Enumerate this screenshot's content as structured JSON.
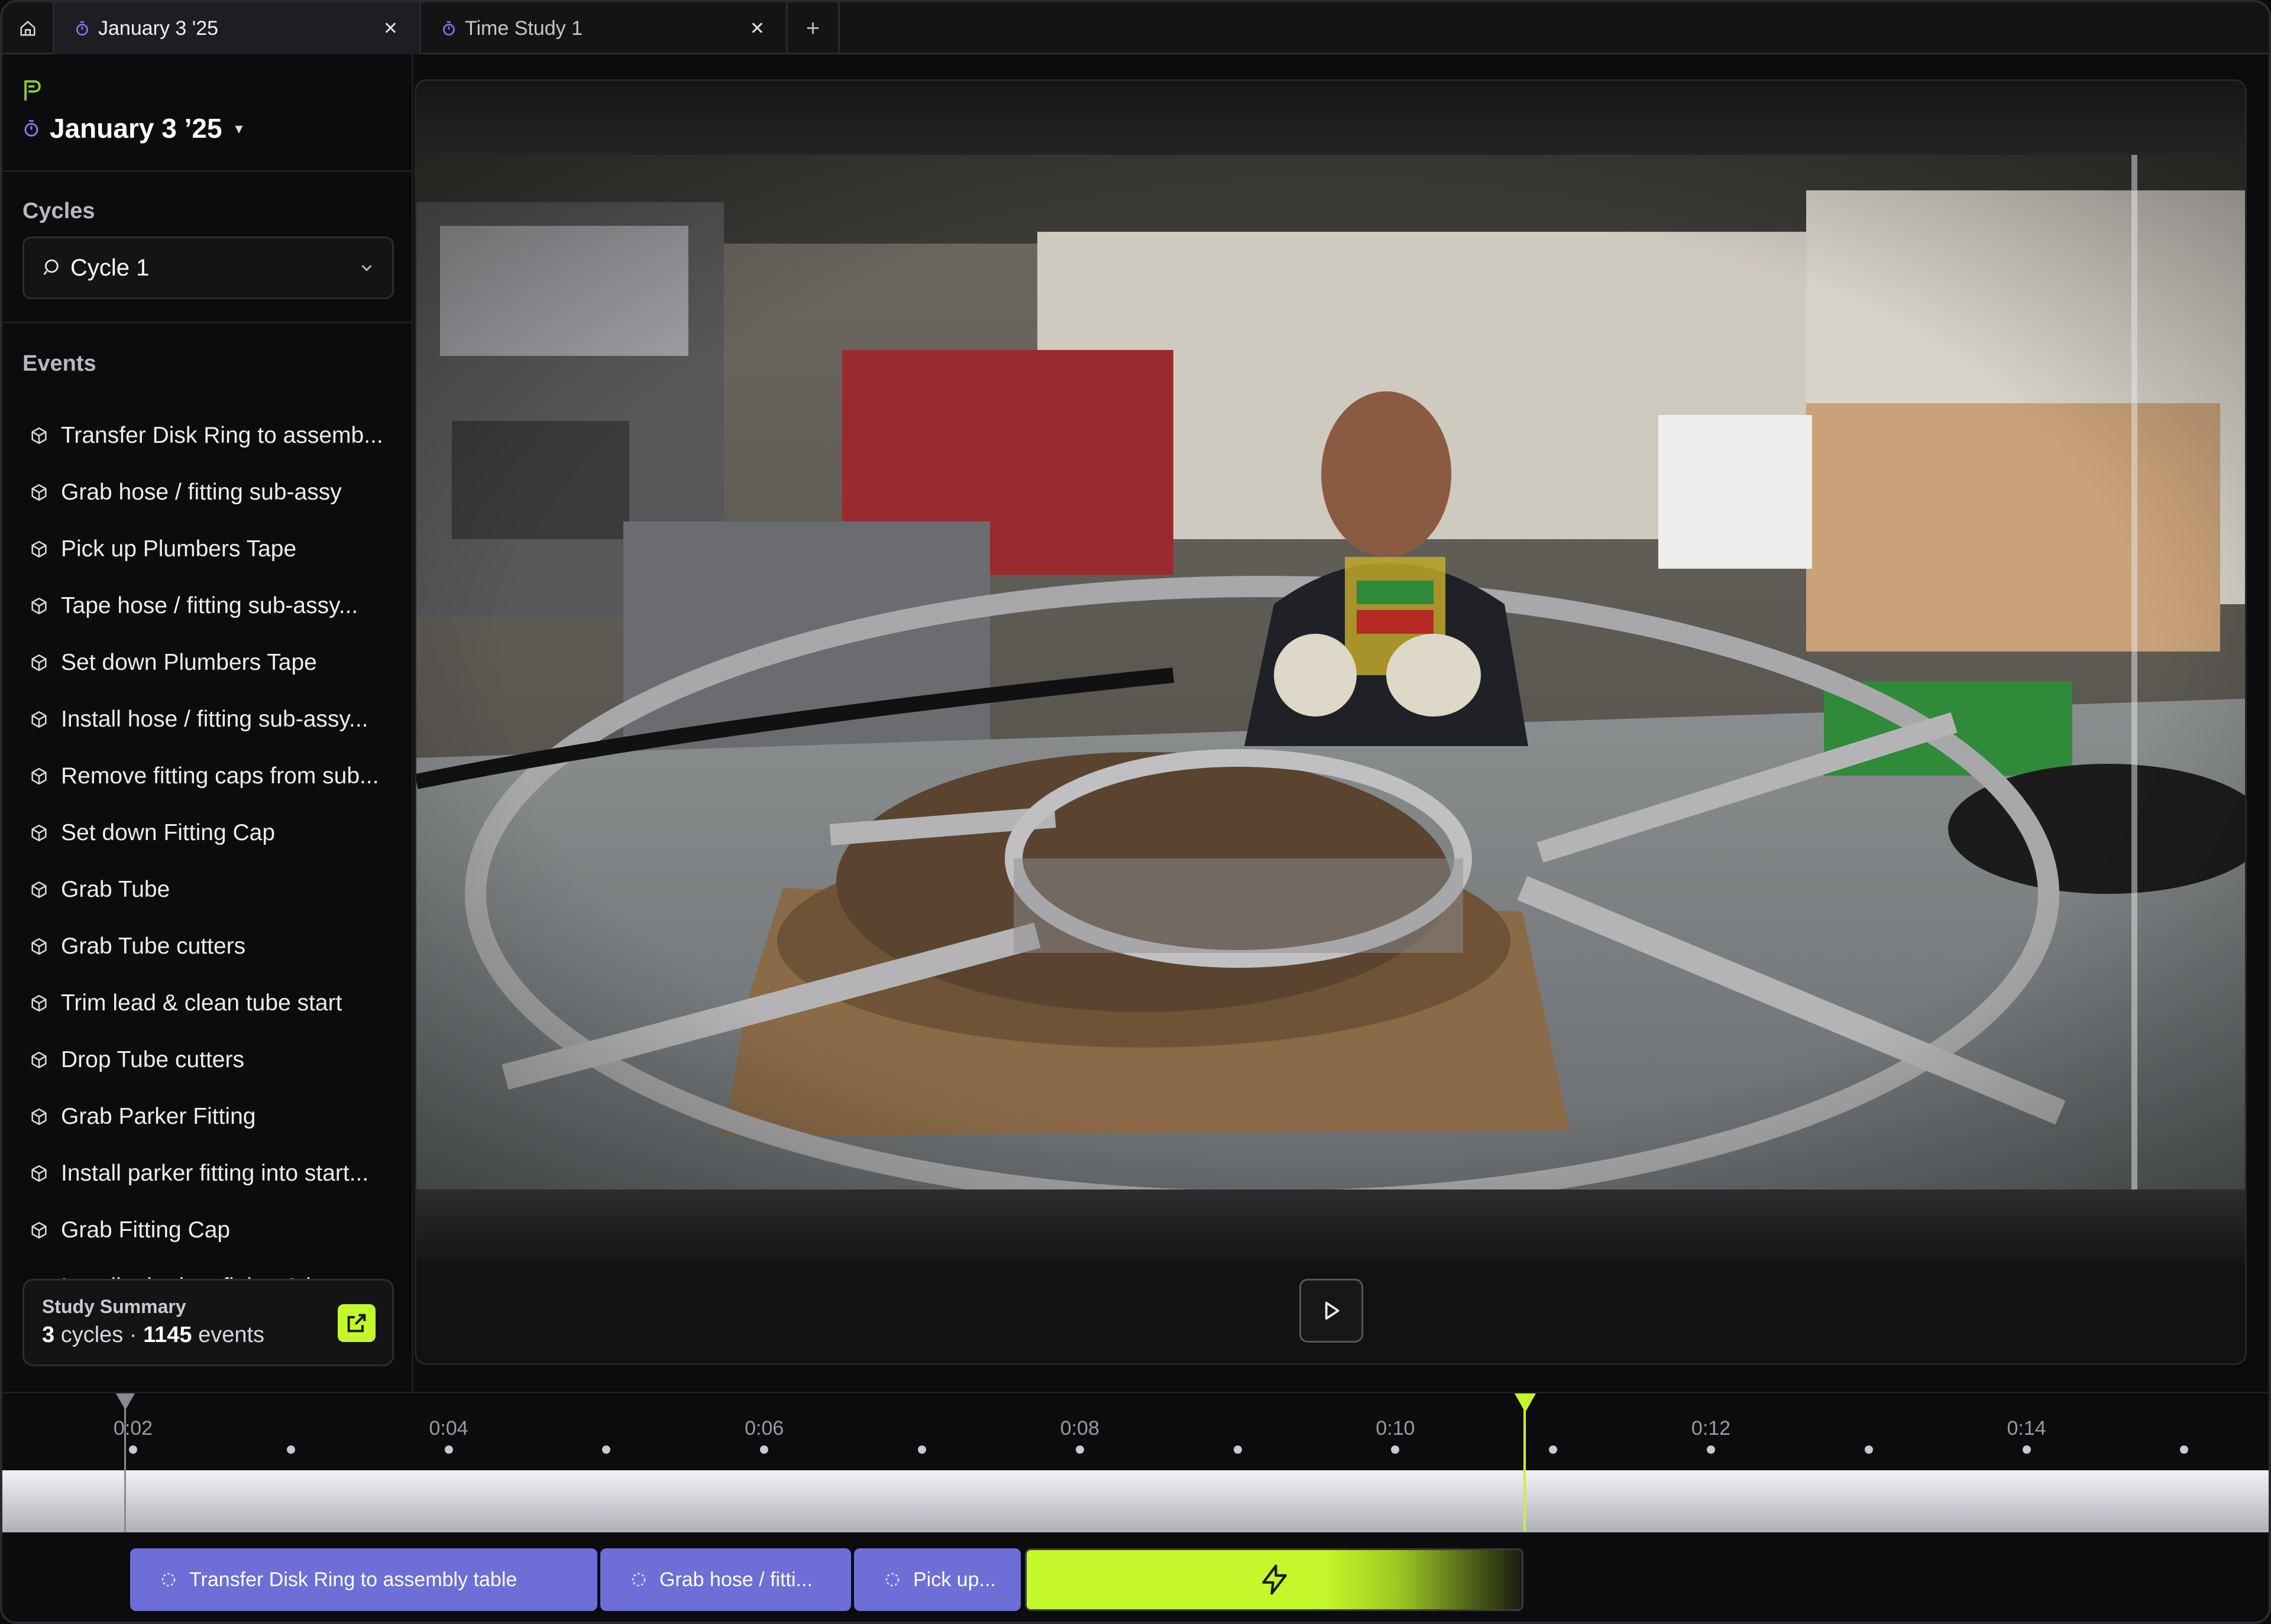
{
  "tabs": [
    {
      "title": "January 3 '25",
      "active": true
    },
    {
      "title": "Time Study 1",
      "active": false
    }
  ],
  "sidebar": {
    "study_title": "January 3 ’25",
    "cycles_heading": "Cycles",
    "cycle_selected": "Cycle 1",
    "events_heading": "Events",
    "events": [
      "Transfer Disk Ring to assemb...",
      "Grab hose / fitting  sub-assy",
      "Pick up Plumbers Tape",
      "Tape hose / fitting  sub-assy...",
      "Set down Plumbers Tape",
      "Install hose / fitting sub-assy...",
      "Remove fitting caps from sub...",
      "Set down Fitting Cap",
      "Grab Tube",
      "Grab Tube cutters",
      "Trim lead & clean tube start",
      "Drop Tube cutters",
      "Grab Parker Fitting",
      "Install parker fitting into start...",
      "Grab Fitting Cap",
      "Install tube into fitting & insta..."
    ],
    "summary": {
      "title": "Study Summary",
      "cycles_count": "3",
      "cycles_word": "cycles",
      "separator": "·",
      "events_count": "1145",
      "events_word": "events"
    }
  },
  "timeline": {
    "ticks": [
      "0:02",
      "0:04",
      "0:06",
      "0:08",
      "0:10",
      "0:12",
      "0:14"
    ],
    "segments": [
      "Transfer Disk Ring to assembly table",
      "Grab hose / fitti...",
      "Pick up..."
    ]
  },
  "colors": {
    "accent": "#c4f82a",
    "segment": "#6d6fd6",
    "background": "#0c0c0e"
  }
}
